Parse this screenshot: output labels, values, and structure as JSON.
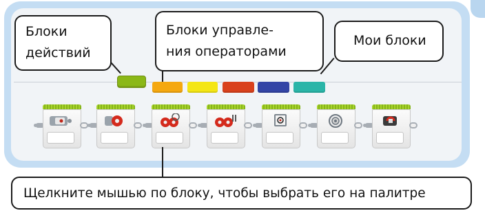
{
  "palette": {
    "tabs": [
      {
        "id": "action",
        "color": "#8bb817"
      },
      {
        "id": "flow",
        "color": "#f5a80f"
      },
      {
        "id": "sensor",
        "color": "#f4e614"
      },
      {
        "id": "data",
        "color": "#d9411c"
      },
      {
        "id": "advanced",
        "color": "#3345a6"
      },
      {
        "id": "my-blocks",
        "color": "#2ab5a8"
      }
    ],
    "blocks": [
      {
        "name": "medium-motor-block",
        "icon": "medium-motor-icon"
      },
      {
        "name": "large-motor-block",
        "icon": "large-motor-icon"
      },
      {
        "name": "move-steering-block",
        "icon": "steering-icon"
      },
      {
        "name": "move-tank-block",
        "icon": "tank-icon"
      },
      {
        "name": "display-block",
        "icon": "display-icon"
      },
      {
        "name": "sound-block",
        "icon": "sound-icon"
      },
      {
        "name": "brick-status-light-block",
        "icon": "brick-light-icon"
      }
    ]
  },
  "callouts": {
    "action_blocks": {
      "line1": "Блоки",
      "line2": "действий"
    },
    "flow_blocks": {
      "line1": "Блоки управле-",
      "line2": "ния операторами"
    },
    "my_blocks": {
      "text": "Мои блоки"
    },
    "instruction": {
      "text": "Щелкните мышью по блоку, чтобы выбрать его на палитре"
    }
  }
}
